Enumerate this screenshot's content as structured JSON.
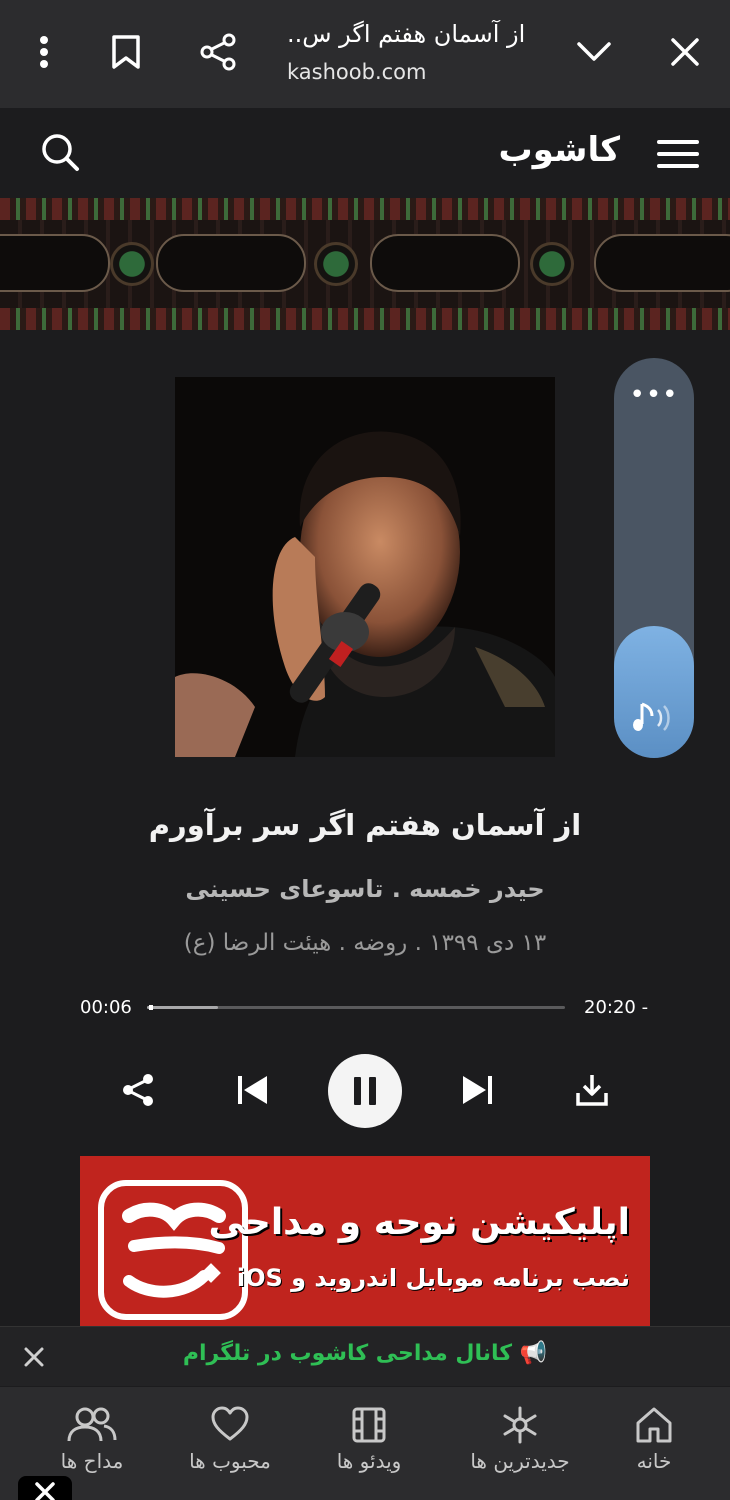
{
  "browser": {
    "title": "از آسمان هفتم اگر س..",
    "url": "kashoob.com",
    "icons": [
      "more-vertical-icon",
      "bookmark-icon",
      "share-icon",
      "chevron-down-icon",
      "close-icon"
    ]
  },
  "site": {
    "logo": "کاشوب",
    "icons": [
      "menu-icon",
      "search-icon"
    ]
  },
  "player": {
    "title": "از آسمان هفتم اگر سر برآورم",
    "artist": "حیدر خمسه . تاسوعای حسینی",
    "meta": "۱۳ دی ۱۳۹۹ . روضه . هیئت الرضا (ع)",
    "time_current": "00:06",
    "time_remaining": "20:20 -",
    "progress_fraction": 0.005,
    "buffer_fraction": 0.17,
    "volume_fraction": 0.33,
    "volume_more": "•••",
    "state": "playing",
    "controls": [
      "share-icon",
      "previous-icon",
      "pause-icon",
      "next-icon",
      "download-icon"
    ]
  },
  "promo": {
    "title": "اپلیکیشن نوحه و مداحی",
    "subtitle": "نصب برنامه موبایل اندروید و iOS",
    "accent": "#c0241e"
  },
  "telegram": {
    "text": "📢 کانال مداحی کاشوب در تلگرام",
    "color": "#2fbf55"
  },
  "nav": {
    "home": "خانه",
    "newest": "جدیدترین ها",
    "videos": "ویدئو ها",
    "favorites": "محبوب ها",
    "eulogists": "مداح ها"
  }
}
